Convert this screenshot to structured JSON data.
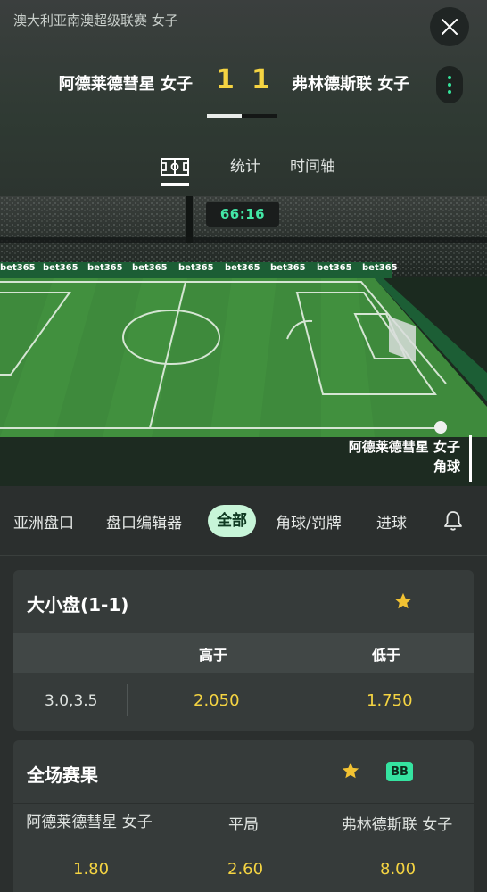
{
  "header": {
    "league": "澳大利亚南澳超级联赛 女子",
    "home_team": "阿德莱德彗星 女子",
    "away_team": "弗林德斯联 女子",
    "home_score": "1",
    "away_score": "1",
    "match_progress": 0.5
  },
  "view_tabs": {
    "pitch_icon": "pitch-icon",
    "stats": "统计",
    "timeline": "时间轴"
  },
  "pitch": {
    "clock": "66:16",
    "sponsor": "bet365",
    "event_team": "阿德莱德彗星 女子",
    "event_type": "角球"
  },
  "market_tabs": [
    "亚洲盘口",
    "盘口编辑器",
    "全部",
    "角球/罚牌",
    "进球"
  ],
  "market_tab_active": "全部",
  "over_under": {
    "title": "大小盘(1-1)",
    "over_label": "高于",
    "under_label": "低于",
    "line": "3.0,3.5",
    "over_odds": "2.050",
    "under_odds": "1.750"
  },
  "full_time": {
    "title": "全场赛果",
    "badge": "BB",
    "home_label": "阿德莱德彗星 女子",
    "draw_label": "平局",
    "away_label": "弗林德斯联 女子",
    "home_odds": "1.80",
    "draw_odds": "2.60",
    "away_odds": "8.00"
  },
  "colors": {
    "accent_green": "#34e39a",
    "odds_yellow": "#f5d442",
    "star_yellow": "#f2c232",
    "active_tab": "#c7f5d8"
  }
}
